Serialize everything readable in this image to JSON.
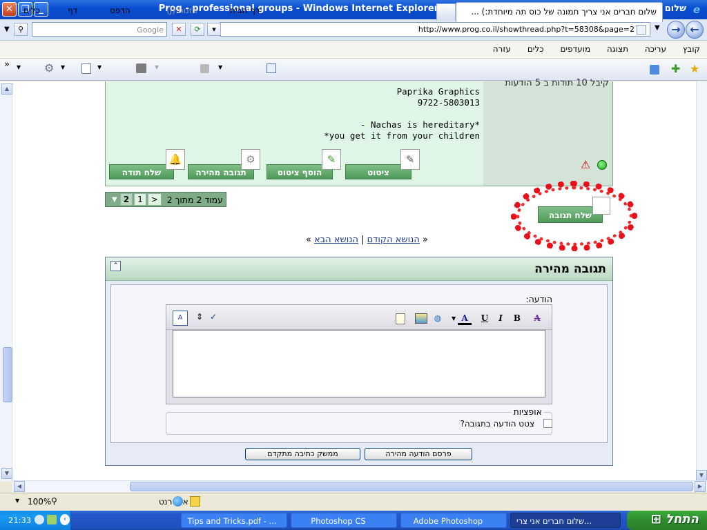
{
  "window": {
    "title": "שלום חברים אני צריך תמונה של כוס תה מיוחדת:) - דף 2 - Prog - professional groups - Windows Internet Explorer"
  },
  "addressbar": {
    "url": "http://www.prog.co.il/showthread.php?t=58308&page=2",
    "search_placeholder": "Google"
  },
  "menu": [
    "קובץ",
    "עריכה",
    "תצוגה",
    "מועדפים",
    "כלים",
    "עזרה"
  ],
  "tab": {
    "label": "שלום חברים אני צריך תמונה של כוס תה מיוחדת:) ..."
  },
  "commands": {
    "home": "דף הבית",
    "feeds": "הזנות (J)",
    "print": "הדפס",
    "page": "דף",
    "tools": "כלים"
  },
  "post": {
    "side_text": "קיבל 10 תודות ב 5 הודעות",
    "signature": "Paprika Graphics\n9722-5803013\n\n- Nachas is hereditary*\n*you get it from your children",
    "buttons": {
      "thanks": "שלח תודה",
      "quick_reply": "תגובה מהירה",
      "multi_quote": "הוסף ציטוט",
      "quote": "ציטוט"
    }
  },
  "pager": {
    "label": "עמוד 2 מתוך 2",
    "prev": "<",
    "pages": [
      "1",
      "2"
    ]
  },
  "reply_button": "שלח תגובה",
  "threadnav": {
    "prev": "הנושא הקודם",
    "next": "הנושא הבא",
    "open": "«",
    "close": "»",
    "separator": "|"
  },
  "quick_reply": {
    "title": "תגובה מהירה",
    "message_label": "הודעה:",
    "options_legend": "אופציות",
    "quote_label": "צטט הודעה בתגובה?",
    "submit": "פרסם הודעה מהירה",
    "advanced": "ממשק כתיבה מתקדם"
  },
  "editor_toolbar": {
    "bold": "B",
    "italic": "I",
    "underline": "U",
    "font_color": "A",
    "remove_format": "A"
  },
  "statusbar": {
    "zoom": "100%",
    "zone": "אינטרנט"
  },
  "taskbar": {
    "start": "התחל",
    "clock": "21:33",
    "tasks": [
      "שלום חברים אני צרי...",
      "Adobe Photoshop",
      "Photoshop CS",
      "Tips and Tricks.pdf - ..."
    ]
  },
  "colors": {
    "post_bg": "#dff5e6",
    "button_green": "#4f9a59",
    "red_highlight": "#e8101a",
    "xp_blue": "#0a4fd1"
  }
}
